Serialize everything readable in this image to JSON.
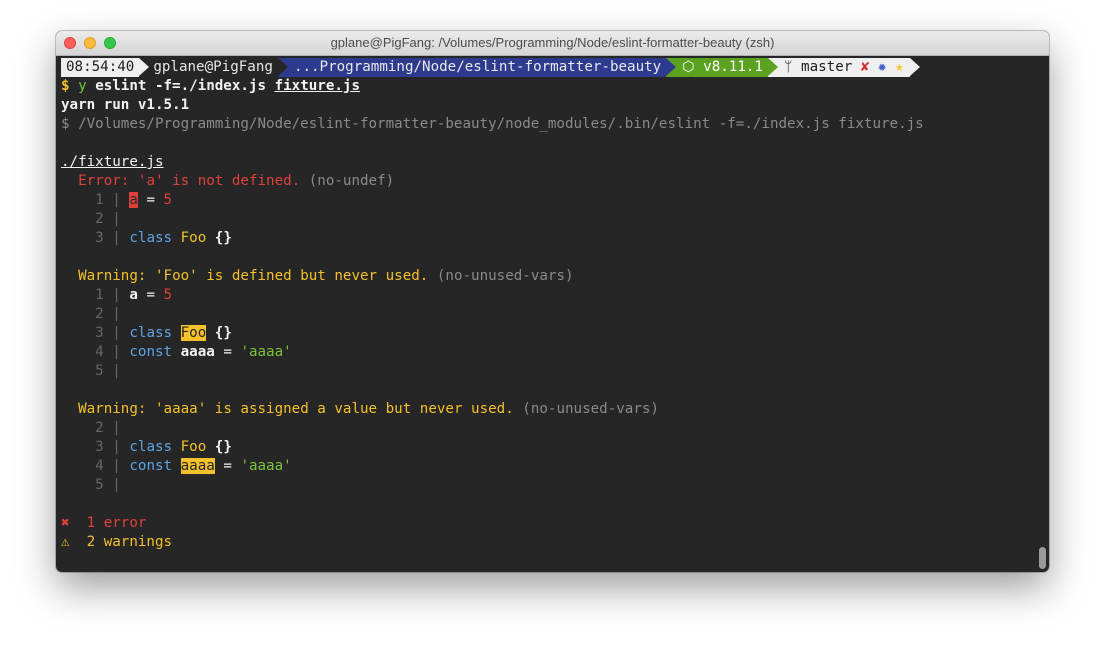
{
  "window": {
    "title": "gplane@PigFang: /Volumes/Programming/Node/eslint-formatter-beauty (zsh)"
  },
  "prompt": {
    "time": "08:54:40",
    "user": "gplane@PigFang",
    "path": "...Programming/Node/eslint-formatter-beauty",
    "node_icon": "⬡",
    "node": "v8.11.1",
    "git_icon": "ᛘ",
    "branch": "master",
    "status_icons": [
      "✘",
      "✹",
      "★"
    ]
  },
  "command": {
    "symbol": "$",
    "name": "y",
    "args": "eslint -f=./index.js",
    "file": "fixture.js"
  },
  "yarn_line": "yarn run v1.5.1",
  "exec_line": "$ /Volumes/Programming/Node/eslint-formatter-beauty/node_modules/.bin/eslint -f=./index.js fixture.js",
  "file_header": "./fixture.js",
  "messages": [
    {
      "kind": "Error",
      "text": "'a' is not defined.",
      "rule": "(no-undef)",
      "lines": [
        {
          "n": "1",
          "sep": "|"
        },
        {
          "n": "2",
          "sep": "|"
        },
        {
          "n": "3",
          "sep": "|"
        }
      ]
    },
    {
      "kind": "Warning",
      "text": "'Foo' is defined but never used.",
      "rule": "(no-unused-vars)",
      "lines": [
        {
          "n": "1",
          "sep": "|"
        },
        {
          "n": "2",
          "sep": "|"
        },
        {
          "n": "3",
          "sep": "|"
        },
        {
          "n": "4",
          "sep": "|"
        },
        {
          "n": "5",
          "sep": "|"
        }
      ]
    },
    {
      "kind": "Warning",
      "text": "'aaaa' is assigned a value but never used.",
      "rule": "(no-unused-vars)",
      "lines": [
        {
          "n": "2",
          "sep": "|"
        },
        {
          "n": "3",
          "sep": "|"
        },
        {
          "n": "4",
          "sep": "|"
        },
        {
          "n": "5",
          "sep": "|"
        }
      ]
    }
  ],
  "code": {
    "var_a": "a",
    "eq": "=",
    "five": "5",
    "kw_class": "class",
    "cls_foo": "Foo",
    "braces": "{}",
    "kw_const": "const",
    "var_aaaa": "aaaa",
    "str_aaaa": "'aaaa'"
  },
  "summary": {
    "error_icon": "✖",
    "errors": "1 error",
    "warn_icon": "⚠",
    "warnings": "2 warnings"
  },
  "colors": {
    "background": "#262626",
    "error": "#e0413a",
    "warning": "#f4c12a",
    "path_segment": "#2c3b8e",
    "node_segment": "#5aa21f"
  }
}
